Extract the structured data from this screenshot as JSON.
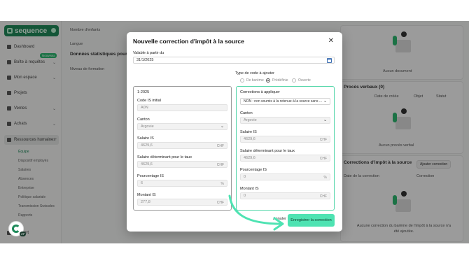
{
  "app": {
    "logo_text": "sequence",
    "badge_new": "Nouveau",
    "nav": [
      {
        "label": "Dashboard"
      },
      {
        "label": "Boîte à requêtes"
      },
      {
        "label": "Mon espace"
      },
      {
        "label": "Projets"
      },
      {
        "label": "Ventes"
      },
      {
        "label": "Achats"
      },
      {
        "label": "Ressources humaines"
      }
    ],
    "sub_items": [
      "Équipe",
      "Dispositif employés",
      "Salaires",
      "Absences",
      "Entreprise",
      "Politique salariale",
      "Transmission Swissdec",
      "Rapports"
    ],
    "footer_nav": "Support",
    "fab_badge": "47"
  },
  "background": {
    "nombre_enfants": "Nombre d'enfants",
    "langue": "Langue",
    "stats_title": "Données statistiques pour l'OFS",
    "niveau_formation": "Niveau de formation",
    "aucun_document": "Aucun document",
    "proces_verbaux": "Procès verbaux (0)",
    "pv_cols": [
      "Date de créée",
      "Objet",
      "Statut"
    ],
    "aucun_pv": "Aucun procès verbal",
    "corrections_title": "Corrections d'impôt à la source",
    "ajouter_correction": "Ajouter correction",
    "corr_cols": [
      "Date de la correction",
      "Correction"
    ],
    "aucune_correction": "Aucune correction du barème de l'impôt à la source n'a été ajoutée."
  },
  "modal": {
    "title": "Nouvelle correction d'impôt à la source",
    "valable_label": "Valable à partir du",
    "valable_value": "31/1/2025",
    "type_label": "Type de code à ajouter",
    "type_options": [
      {
        "label": "De barème",
        "checked": false
      },
      {
        "label": "Prédéfinie",
        "checked": true
      },
      {
        "label": "Ouverte",
        "checked": false
      }
    ],
    "left": {
      "period": "1-2025",
      "code_label": "Code IS initial",
      "code_value": "A0N",
      "canton_label": "Canton",
      "canton_value": "Argovie",
      "salaire_label": "Salaire IS",
      "salaire_value": "4629,6",
      "salaire_taux_label": "Salaire déterminant pour le taux",
      "salaire_taux_value": "4629,6",
      "pourcentage_label": "Pourcentage IS",
      "pourcentage_value": "6",
      "montant_label": "Montant IS",
      "montant_value": "277,8"
    },
    "right": {
      "corrections_label": "Corrections à appliquer",
      "corrections_value": "NON : non soumis à la retenue à la source sans ...",
      "canton_label": "Canton",
      "canton_value": "Argovie",
      "salaire_label": "Salaire IS",
      "salaire_value": "4629,6",
      "salaire_taux_label": "Salaire déterminant pour le taux",
      "salaire_taux_value": "4629,6",
      "pourcentage_label": "Pourcentage IS",
      "pourcentage_value": "0",
      "montant_label": "Montant IS",
      "montant_value": "0"
    },
    "unit_chf": "CHF",
    "unit_pct": "%",
    "cancel_label": "Annuler",
    "save_label": "Enregistrer la correction"
  },
  "colors": {
    "brand_green": "#1f8a5a",
    "save_button": "#4ee3b2",
    "card_highlight": "#53d6a9"
  }
}
